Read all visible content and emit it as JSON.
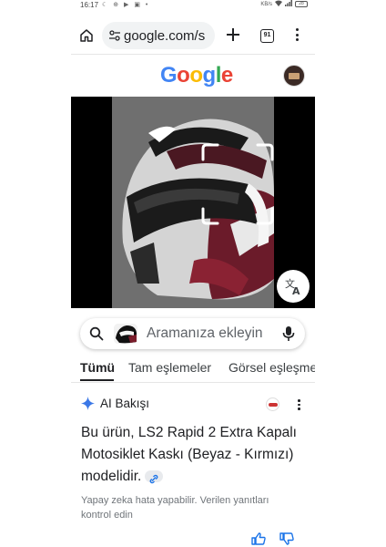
{
  "status_bar": {
    "time": "16:17",
    "left_icons": "☾ ⊕ ▶ ▣ •",
    "network": "KB/s",
    "battery": "28"
  },
  "browser": {
    "url": "google.com/s",
    "tab_count": "91"
  },
  "google": {
    "logo_letters": [
      "G",
      "o",
      "o",
      "g",
      "l",
      "e"
    ],
    "logo_colors": [
      "#4285F4",
      "#EA4335",
      "#FBBC05",
      "#4285F4",
      "#34A853",
      "#EA4335"
    ]
  },
  "search": {
    "placeholder": "Aramanıza ekleyin"
  },
  "filters": {
    "items": [
      "Tümü",
      "Tam eşlemeler",
      "Görsel eşleşmeler"
    ],
    "active_index": 0
  },
  "ai_overview": {
    "title": "AI Bakışı",
    "body": "Bu ürün, LS2 Rapid 2 Extra Kapalı Motosiklet Kaskı (Beyaz - Kırmızı) modelidir.",
    "disclaimer": "Yapay zeka hata yapabilir. Verilen yanıtları kontrol edin"
  },
  "icons": {
    "home": "home-icon",
    "tune": "tune-icon",
    "new_tab": "plus-icon",
    "tabs": "tab-switcher-icon",
    "menu": "more-vert-icon",
    "translate": "translate-icon",
    "search": "search-icon",
    "mic": "mic-icon",
    "sparkle": "gemini-sparkle-icon",
    "link": "link-icon",
    "thumb_up": "thumb-up-icon",
    "thumb_down": "thumb-down-icon"
  }
}
